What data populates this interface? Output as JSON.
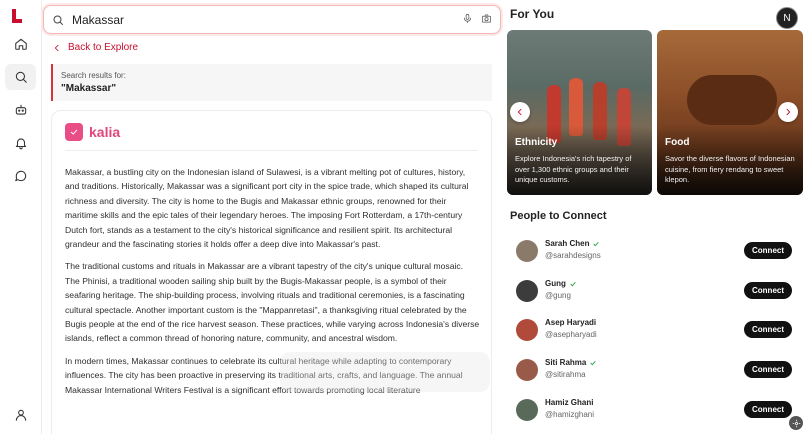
{
  "search": {
    "query": "Makassar"
  },
  "nav": {
    "back_label": "Back to Explore"
  },
  "results": {
    "label": "Search results for:",
    "term": "\"Makassar\""
  },
  "brand": {
    "name": "kalia",
    "color": "#e94d86"
  },
  "article": {
    "paragraphs": [
      "Makassar, a bustling city on the Indonesian island of Sulawesi, is a vibrant melting pot of cultures, history, and traditions. Historically, Makassar was a significant port city in the spice trade, which shaped its cultural richness and diversity. The city is home to the Bugis and Makassar ethnic groups, renowned for their maritime skills and the epic tales of their legendary heroes. The imposing Fort Rotterdam, a 17th-century Dutch fort, stands as a testament to the city's historical significance and resilient spirit. Its architectural grandeur and the fascinating stories it holds offer a deep dive into Makassar's past.",
      "The traditional customs and rituals in Makassar are a vibrant tapestry of the city's unique cultural mosaic. The Phinisi, a traditional wooden sailing ship built by the Bugis-Makassar people, is a symbol of their seafaring heritage. The ship-building process, involving rituals and traditional ceremonies, is a fascinating cultural spectacle. Another important custom is the \"Mappanretasi\", a thanksgiving ritual celebrated by the Bugis people at the end of the rice harvest season. These practices, while varying across Indonesia's diverse islands, reflect a common thread of honoring nature, community, and ancestral wisdom.",
      "In modern times, Makassar continues to celebrate its cultural heritage while adapting to contemporary influences. The city has been proactive in preserving its traditional arts, crafts, and language. The annual Makassar International Writers Festival is a significant effort towards promoting local literature"
    ]
  },
  "for_you": {
    "title": "For You",
    "user_initial": "N",
    "tiles": [
      {
        "title": "Ethnicity",
        "desc": "Explore Indonesia's rich tapestry of over 1,300 ethnic groups and their unique customs."
      },
      {
        "title": "Food",
        "desc": "Savor the diverse flavors of Indonesian cuisine, from fiery rendang to sweet klepon."
      }
    ]
  },
  "people": {
    "title": "People to Connect",
    "connect_label": "Connect",
    "list": [
      {
        "name": "Sarah Chen",
        "handle": "@sarahdesigns",
        "verified": true,
        "color": "#8a7a6a"
      },
      {
        "name": "Gung",
        "handle": "@gung",
        "verified": true,
        "color": "#3c3c3c"
      },
      {
        "name": "Asep Haryadi",
        "handle": "@asepharyadi",
        "verified": false,
        "color": "#b04a3a"
      },
      {
        "name": "Siti Rahma",
        "handle": "@sitirahma",
        "verified": true,
        "color": "#9a5a4a"
      },
      {
        "name": "Hamiz Ghani",
        "handle": "@hamizghani",
        "verified": false,
        "color": "#5a6a5a"
      }
    ]
  },
  "colors": {
    "accent": "#c8102e",
    "brand_pink": "#e0457b"
  }
}
